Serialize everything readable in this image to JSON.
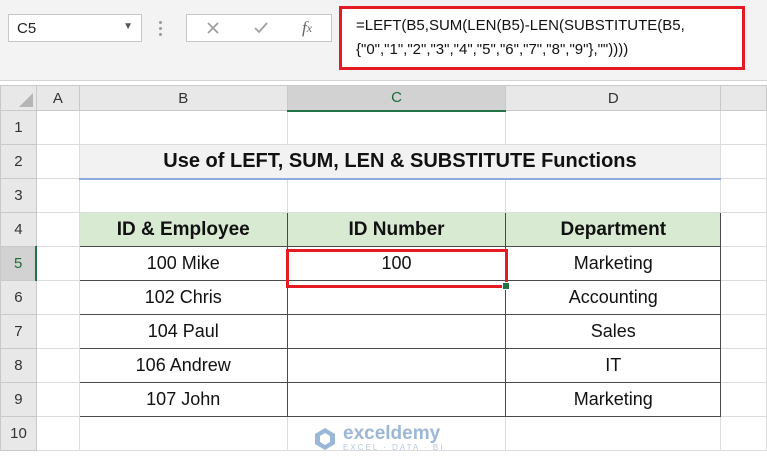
{
  "formula_bar": {
    "name_box": "C5",
    "formula_line1": "=LEFT(B5,SUM(LEN(B5)-LEN(SUBSTITUTE(B5,",
    "formula_line2": "{\"0\",\"1\",\"2\",\"3\",\"4\",\"5\",\"6\",\"7\",\"8\",\"9\"},\"\"))))",
    "cancel_icon": "x-icon",
    "enter_icon": "check-icon",
    "function_icon": "fx-icon"
  },
  "columns": [
    "A",
    "B",
    "C",
    "D"
  ],
  "rows": [
    "1",
    "2",
    "3",
    "4",
    "5",
    "6",
    "7",
    "8",
    "9",
    "10"
  ],
  "title": "Use of LEFT, SUM, LEN & SUBSTITUTE Functions",
  "table": {
    "headers": [
      "ID & Employee",
      "ID Number",
      "Department"
    ],
    "rows": [
      [
        "100 Mike",
        "100",
        "Marketing"
      ],
      [
        "102 Chris",
        "",
        "Accounting"
      ],
      [
        "104 Paul",
        "",
        "Sales"
      ],
      [
        "106 Andrew",
        "",
        "IT"
      ],
      [
        "107 John",
        "",
        "Marketing"
      ]
    ]
  },
  "watermark": {
    "name": "exceldemy",
    "tagline": "EXCEL · DATA · BI"
  },
  "colors": {
    "highlight_red": "#e41b23",
    "header_green": "#d9ead3",
    "excel_green": "#217346"
  }
}
